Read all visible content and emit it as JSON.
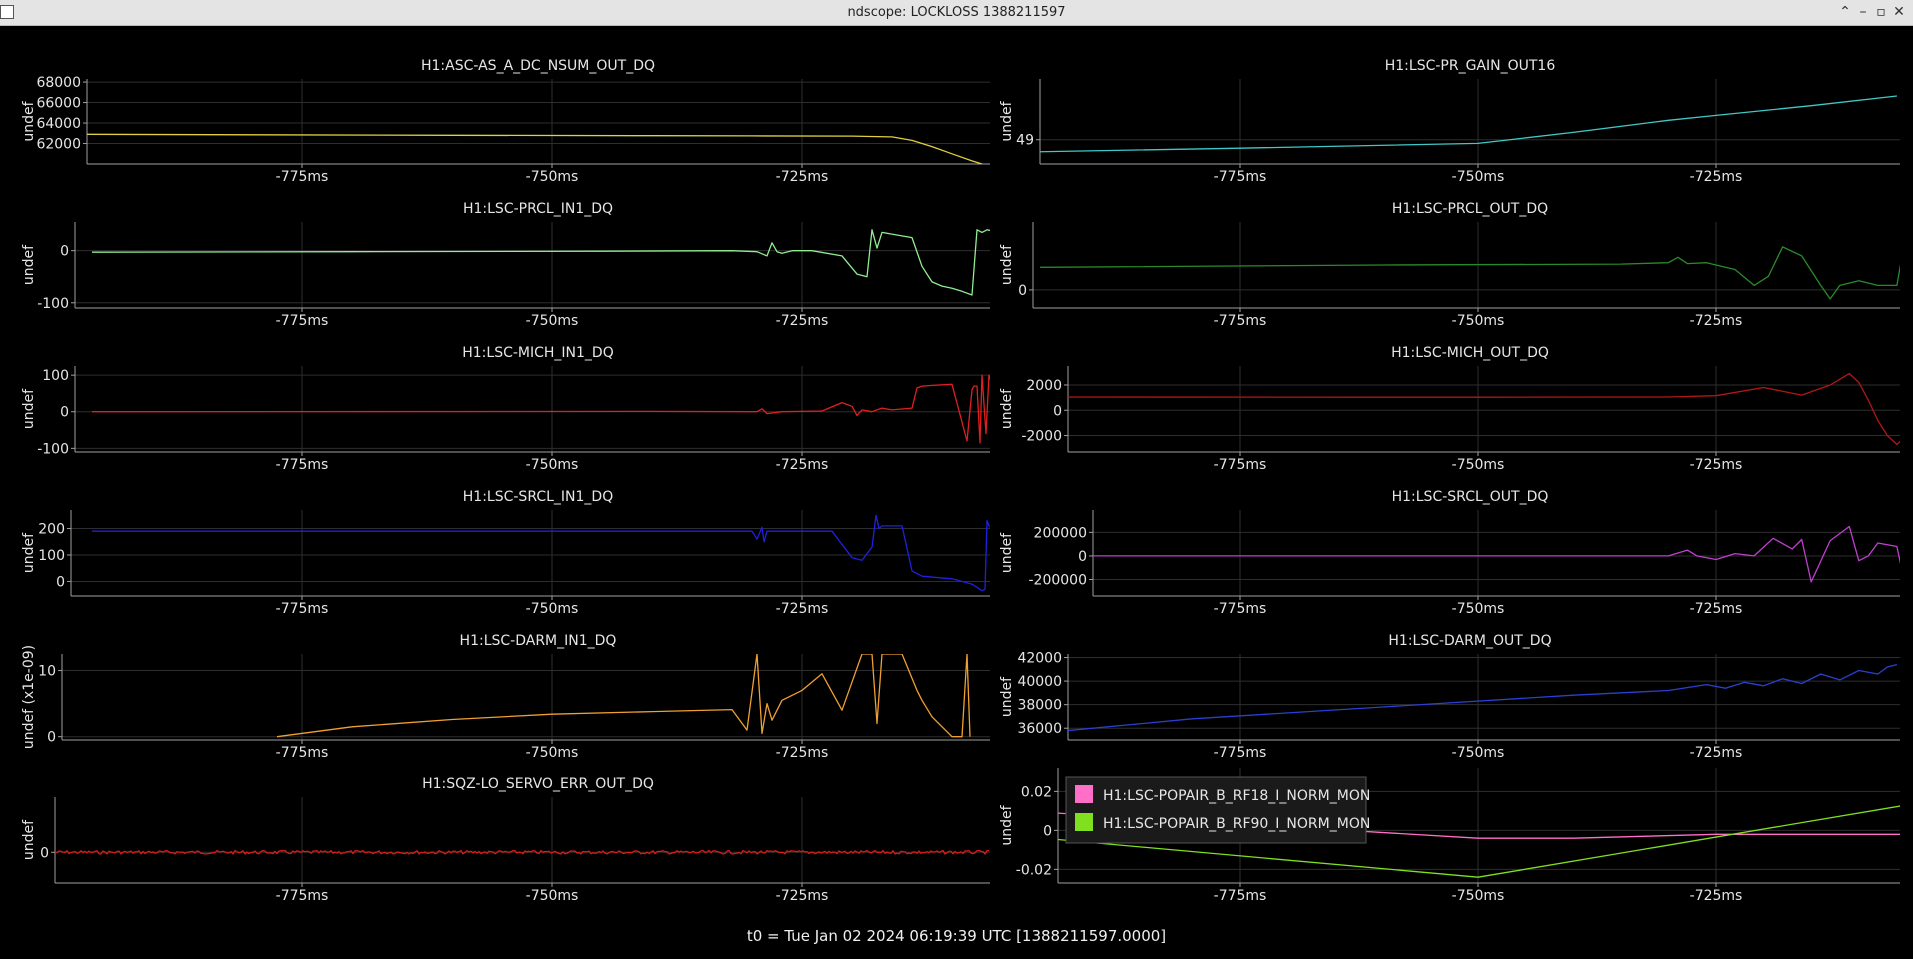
{
  "window": {
    "title": "ndscope: LOCKLOSS 1388211597",
    "buttons": {
      "restore": "⌃",
      "minimize": "–",
      "maximize": "▫",
      "close": "✕"
    }
  },
  "t0_label": "t0 = Tue Jan 02 2024 06:19:39 UTC [1388211597.0000]",
  "colors": {
    "background": "#000000",
    "grid": "#2e2e2e",
    "axis": "#a0a0a0",
    "text": "#e6e6e6"
  },
  "chart_data": [
    {
      "type": "line",
      "title": "H1:ASC-AS_A_DC_NSUM_OUT_DQ",
      "ylabel": "undef",
      "xticks": [
        "-775ms",
        "-750ms",
        "-725ms"
      ],
      "yticks": [
        {
          "value": 62000,
          "label": "62000"
        },
        {
          "value": 64000,
          "label": "64000"
        },
        {
          "value": 66000,
          "label": "66000"
        },
        {
          "value": 68000,
          "label": "68000"
        }
      ],
      "xlim": [
        -797,
        -707
      ],
      "ylim": [
        60000,
        68300
      ],
      "series": [
        {
          "color": "#e0d040",
          "x": [
            -797,
            -780,
            -760,
            -740,
            -730,
            -720,
            -716,
            -714,
            -712,
            -710,
            -708,
            -707
          ],
          "y": [
            62900,
            62850,
            62800,
            62760,
            62740,
            62720,
            62650,
            62300,
            61700,
            61000,
            60300,
            60000
          ]
        }
      ]
    },
    {
      "type": "line",
      "title": "H1:LSC-PR_GAIN_OUT16",
      "ylabel": "undef",
      "xticks": [
        "-775ms",
        "-750ms",
        "-725ms"
      ],
      "yticks": [
        {
          "value": 49,
          "label": "49"
        }
      ],
      "xlim": [
        -797,
        -706
      ],
      "ylim": [
        48.9,
        49.25
      ],
      "series": [
        {
          "color": "#40c8c8",
          "x": [
            -797,
            -775,
            -750,
            -740,
            -730,
            -725,
            -715,
            -706
          ],
          "y": [
            48.95,
            48.965,
            48.985,
            49.03,
            49.08,
            49.1,
            49.14,
            49.18
          ]
        }
      ]
    },
    {
      "type": "line",
      "title": "H1:LSC-PRCL_IN1_DQ",
      "ylabel": "undef",
      "xticks": [
        "-775ms",
        "-750ms",
        "-725ms"
      ],
      "yticks": [
        {
          "value": 0,
          "label": "0"
        },
        {
          "value": -100,
          "label": "-100"
        }
      ],
      "xlim": [
        -796,
        -706
      ],
      "ylim": [
        -110,
        55
      ],
      "series": [
        {
          "color": "#90ee90",
          "x": [
            -796,
            -770,
            -745,
            -732,
            -729.5,
            -728.5,
            -728,
            -727.5,
            -727,
            -726,
            -724,
            -721,
            -719.5,
            -718.5,
            -718,
            -717.5,
            -717,
            -714,
            -713,
            -712,
            -711,
            -710,
            -709,
            -708,
            -707.5,
            -707,
            -706.5,
            -706
          ],
          "y": [
            -3,
            -2,
            -1,
            0,
            -2,
            -10,
            15,
            -2,
            -5,
            0,
            0,
            -10,
            -45,
            -50,
            40,
            5,
            35,
            25,
            -30,
            -60,
            -68,
            -72,
            -78,
            -85,
            40,
            35,
            40,
            38
          ]
        }
      ]
    },
    {
      "type": "line",
      "title": "H1:LSC-PRCL_OUT_DQ",
      "ylabel": "undef",
      "xticks": [
        "-775ms",
        "-750ms",
        "-725ms"
      ],
      "yticks": [
        {
          "value": 0,
          "label": "0"
        }
      ],
      "xlim": [
        -796,
        -705
      ],
      "ylim": [
        -0.4,
        1.5
      ],
      "series": [
        {
          "color": "#2a8a2a",
          "x": [
            -796,
            -760,
            -735,
            -730,
            -729,
            -728,
            -726,
            -723,
            -721,
            -719.5,
            -718,
            -716,
            -714,
            -713,
            -712,
            -710,
            -708,
            -706,
            -705
          ],
          "y": [
            0.5,
            0.55,
            0.57,
            0.6,
            0.72,
            0.58,
            0.6,
            0.45,
            0.1,
            0.3,
            0.95,
            0.75,
            0.1,
            -0.2,
            0.1,
            0.2,
            0.1,
            0.1,
            1.3
          ]
        }
      ]
    },
    {
      "type": "line",
      "title": "H1:LSC-MICH_IN1_DQ",
      "ylabel": "undef",
      "xticks": [
        "-775ms",
        "-750ms",
        "-725ms"
      ],
      "yticks": [
        {
          "value": 100,
          "label": "100"
        },
        {
          "value": 0,
          "label": "0"
        },
        {
          "value": -100,
          "label": "-100"
        }
      ],
      "xlim": [
        -796,
        -706
      ],
      "ylim": [
        -110,
        125
      ],
      "series": [
        {
          "color": "#e02020",
          "x": [
            -796,
            -740,
            -729.5,
            -729,
            -728.5,
            -727,
            -723,
            -721,
            -720,
            -719.5,
            -719,
            -718,
            -717,
            -716,
            -714,
            -713.5,
            -713,
            -712,
            -710,
            -708.5,
            -708,
            -707.8,
            -707.5,
            -707.2,
            -707,
            -706.6,
            -706.3,
            -706
          ],
          "y": [
            0,
            1,
            0,
            8,
            -5,
            0,
            2,
            25,
            15,
            -10,
            5,
            0,
            10,
            5,
            10,
            65,
            70,
            72,
            75,
            -80,
            60,
            70,
            70,
            -85,
            100,
            -60,
            100,
            75
          ]
        }
      ]
    },
    {
      "type": "line",
      "title": "H1:LSC-MICH_OUT_DQ",
      "ylabel": "undef",
      "xticks": [
        "-775ms",
        "-750ms",
        "-725ms"
      ],
      "yticks": [
        {
          "value": 2000,
          "label": "2000"
        },
        {
          "value": 0,
          "label": "0"
        },
        {
          "value": -2000,
          "label": "-2000"
        }
      ],
      "xlim": [
        -797,
        -705
      ],
      "ylim": [
        -3300,
        3500
      ],
      "series": [
        {
          "color": "#b01818",
          "x": [
            -797,
            -750,
            -730,
            -725,
            -720,
            -716,
            -713,
            -711,
            -710,
            -709,
            -708,
            -707,
            -706,
            -705
          ],
          "y": [
            1050,
            1030,
            1050,
            1150,
            1800,
            1200,
            2000,
            2900,
            2200,
            800,
            -800,
            -2000,
            -2700,
            -2000
          ]
        }
      ]
    },
    {
      "type": "line",
      "title": "H1:LSC-SRCL_IN1_DQ",
      "ylabel": "undef",
      "xticks": [
        "-775ms",
        "-750ms",
        "-725ms"
      ],
      "yticks": [
        {
          "value": 200,
          "label": "200"
        },
        {
          "value": 100,
          "label": "100"
        },
        {
          "value": 0,
          "label": "0"
        }
      ],
      "xlim": [
        -796,
        -706
      ],
      "ylim": [
        -55,
        270
      ],
      "series": [
        {
          "color": "#2020e0",
          "x": [
            -796,
            -732,
            -730,
            -729.5,
            -729,
            -728.8,
            -728.5,
            -728,
            -722,
            -720,
            -719,
            -718,
            -717.6,
            -717.3,
            -717,
            -715,
            -714,
            -713,
            -710,
            -708,
            -707,
            -706.7,
            -706.5,
            -706.3,
            -706
          ],
          "y": [
            190,
            190,
            190,
            160,
            205,
            150,
            190,
            190,
            190,
            90,
            80,
            130,
            250,
            200,
            210,
            210,
            40,
            20,
            10,
            -10,
            -35,
            -30,
            230,
            210,
            200
          ]
        }
      ]
    },
    {
      "type": "line",
      "title": "H1:LSC-SRCL_OUT_DQ",
      "ylabel": "undef",
      "xticks": [
        "-775ms",
        "-750ms",
        "-725ms"
      ],
      "yticks": [
        {
          "value": 200000,
          "label": "200000"
        },
        {
          "value": 0,
          "label": "0"
        },
        {
          "value": -200000,
          "label": "-200000"
        }
      ],
      "xlim": [
        -798,
        -705
      ],
      "ylim": [
        -340000,
        390000
      ],
      "series": [
        {
          "color": "#c040d0",
          "x": [
            -798,
            -730,
            -728,
            -727,
            -725,
            -723,
            -721,
            -719,
            -717,
            -716,
            -715,
            -713,
            -711,
            -710,
            -709,
            -708,
            -706,
            -705
          ],
          "y": [
            0,
            0,
            50000,
            0,
            -30000,
            20000,
            0,
            150000,
            60000,
            140000,
            -220000,
            130000,
            250000,
            -40000,
            0,
            110000,
            80000,
            -300000
          ]
        }
      ]
    },
    {
      "type": "line",
      "title": "H1:LSC-DARM_IN1_DQ",
      "ylabel": "undef (x1e-09)",
      "xticks": [
        "-775ms",
        "-750ms",
        "-725ms"
      ],
      "yticks": [
        {
          "value": 10,
          "label": "10"
        },
        {
          "value": 0,
          "label": "0"
        }
      ],
      "xlim": [
        -798,
        -706
      ],
      "ylim": [
        -0.5,
        12.5
      ],
      "series": [
        {
          "color": "#f0a030",
          "x": [
            -777.5,
            -770,
            -760,
            -750,
            -740,
            -732,
            -730.5,
            -729.5,
            -729,
            -728.5,
            -728,
            -727,
            -725,
            -723,
            -721,
            -719,
            -718,
            -717.5,
            -717,
            -716,
            -715,
            -713.5,
            -713,
            -712,
            -710,
            -709,
            -708.5,
            -708.2
          ],
          "y": [
            0,
            1.5,
            2.6,
            3.4,
            3.8,
            4.1,
            1.0,
            12.5,
            0.5,
            5.0,
            2.5,
            5.5,
            7.0,
            9.5,
            4.0,
            12.5,
            12.5,
            2.0,
            12.5,
            12.5,
            12.5,
            7.0,
            5.5,
            3.0,
            0,
            0,
            12.5,
            0
          ]
        }
      ]
    },
    {
      "type": "line",
      "title": "H1:LSC-DARM_OUT_DQ",
      "ylabel": "undef",
      "xticks": [
        "-775ms",
        "-750ms",
        "-725ms"
      ],
      "yticks": [
        {
          "value": 42000,
          "label": "42000"
        },
        {
          "value": 40000,
          "label": "40000"
        },
        {
          "value": 38000,
          "label": "38000"
        },
        {
          "value": 36000,
          "label": "36000"
        }
      ],
      "xlim": [
        -797,
        -706
      ],
      "ylim": [
        35000,
        42300
      ],
      "series": [
        {
          "color": "#2a40d0",
          "x": [
            -797,
            -780,
            -760,
            -740,
            -730,
            -726,
            -724,
            -722,
            -720,
            -718,
            -716,
            -714,
            -712,
            -710,
            -708,
            -707,
            -706
          ],
          "y": [
            35500,
            36800,
            37800,
            38800,
            39200,
            39700,
            39400,
            39900,
            39600,
            40200,
            39800,
            40600,
            40100,
            40900,
            40600,
            41200,
            41400
          ]
        }
      ]
    },
    {
      "type": "line",
      "title": "H1:SQZ-LO_SERVO_ERR_OUT_DQ",
      "ylabel": "undef",
      "xticks": [
        "-775ms",
        "-750ms",
        "-725ms"
      ],
      "yticks": [
        {
          "value": 0,
          "label": "0"
        }
      ],
      "xlim": [
        -800,
        -706
      ],
      "ylim": [
        -1.0,
        1.8
      ],
      "series": [
        {
          "color": "#e01818",
          "x": [
            -800,
            -706
          ],
          "y": [
            0,
            0
          ]
        }
      ]
    },
    {
      "type": "line",
      "title": "",
      "ylabel": "undef",
      "xticks": [
        "-775ms",
        "-750ms",
        "-725ms"
      ],
      "yticks": [
        {
          "value": 0.02,
          "label": "0.02"
        },
        {
          "value": 0,
          "label": "0"
        },
        {
          "value": -0.02,
          "label": "-0.02"
        }
      ],
      "xlim": [
        -798,
        -705
      ],
      "ylim": [
        -0.027,
        0.032
      ],
      "legend": "top-left",
      "series": [
        {
          "name": "H1:LSC-POPAIR_B_RF18_I_NORM_MON",
          "color": "#ff6ec7",
          "x": [
            -798,
            -750,
            -740,
            -725,
            -705
          ],
          "y": [
            0.01,
            -0.004,
            -0.004,
            -0.002,
            -0.002
          ]
        },
        {
          "name": "H1:LSC-POPAIR_B_RF90_I_NORM_MON",
          "color": "#80e020",
          "x": [
            -798,
            -750,
            -705
          ],
          "y": [
            -0.003,
            -0.024,
            0.013
          ]
        }
      ]
    }
  ]
}
